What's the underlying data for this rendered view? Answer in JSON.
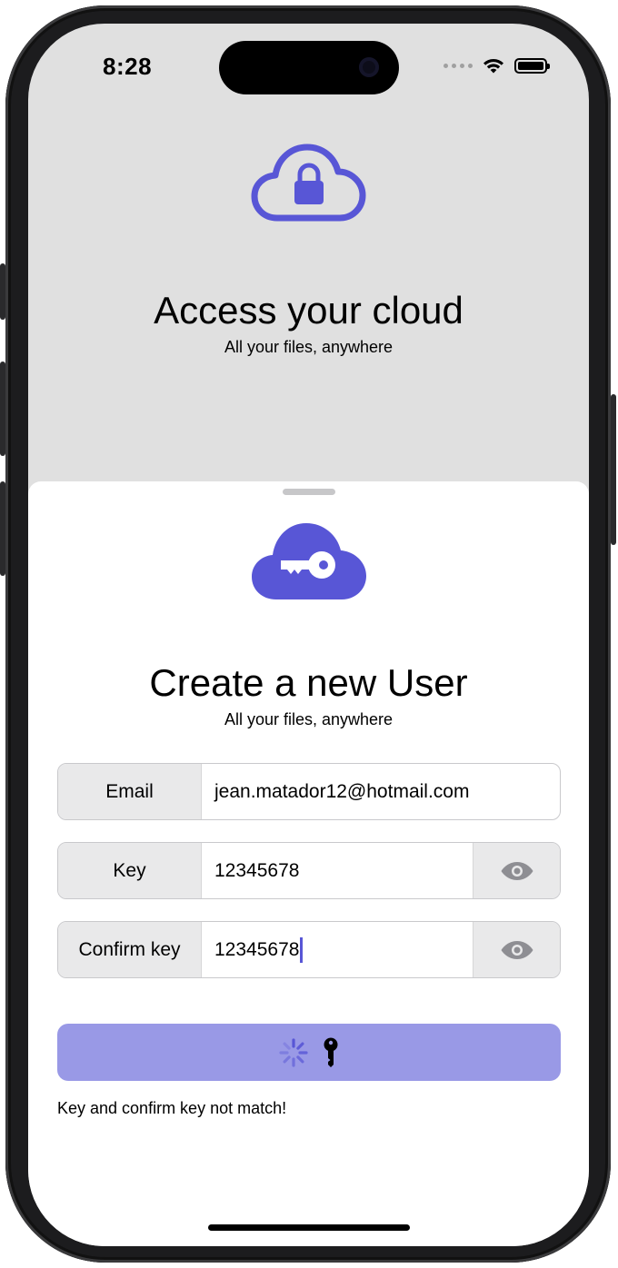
{
  "status_bar": {
    "time": "8:28",
    "wifi_icon": "wifi-icon",
    "battery_icon": "battery-icon"
  },
  "background": {
    "icon": "lock-cloud-icon",
    "title": "Access your cloud",
    "subtitle": "All your files, anywhere"
  },
  "sheet": {
    "icon": "key-cloud-icon",
    "title": "Create a new User",
    "subtitle": "All your files, anywhere",
    "fields": {
      "email": {
        "label": "Email",
        "value": "jean.matador12@hotmail.com"
      },
      "key": {
        "label": "Key",
        "value": "12345678",
        "toggle_icon": "eye-icon"
      },
      "confirm": {
        "label": "Confirm key",
        "value": "12345678",
        "toggle_icon": "eye-icon"
      }
    },
    "submit_button": {
      "spinner_icon": "spinner-icon",
      "key_icon": "key-icon",
      "state": "loading"
    },
    "error_message": "Key and confirm key not match!"
  },
  "colors": {
    "accent": "#5856D6",
    "button_disabled": "#9999E6",
    "background": "#E0E0E0",
    "field_label_bg": "#E9E9EA",
    "eye_icon": "#8E8E93"
  }
}
